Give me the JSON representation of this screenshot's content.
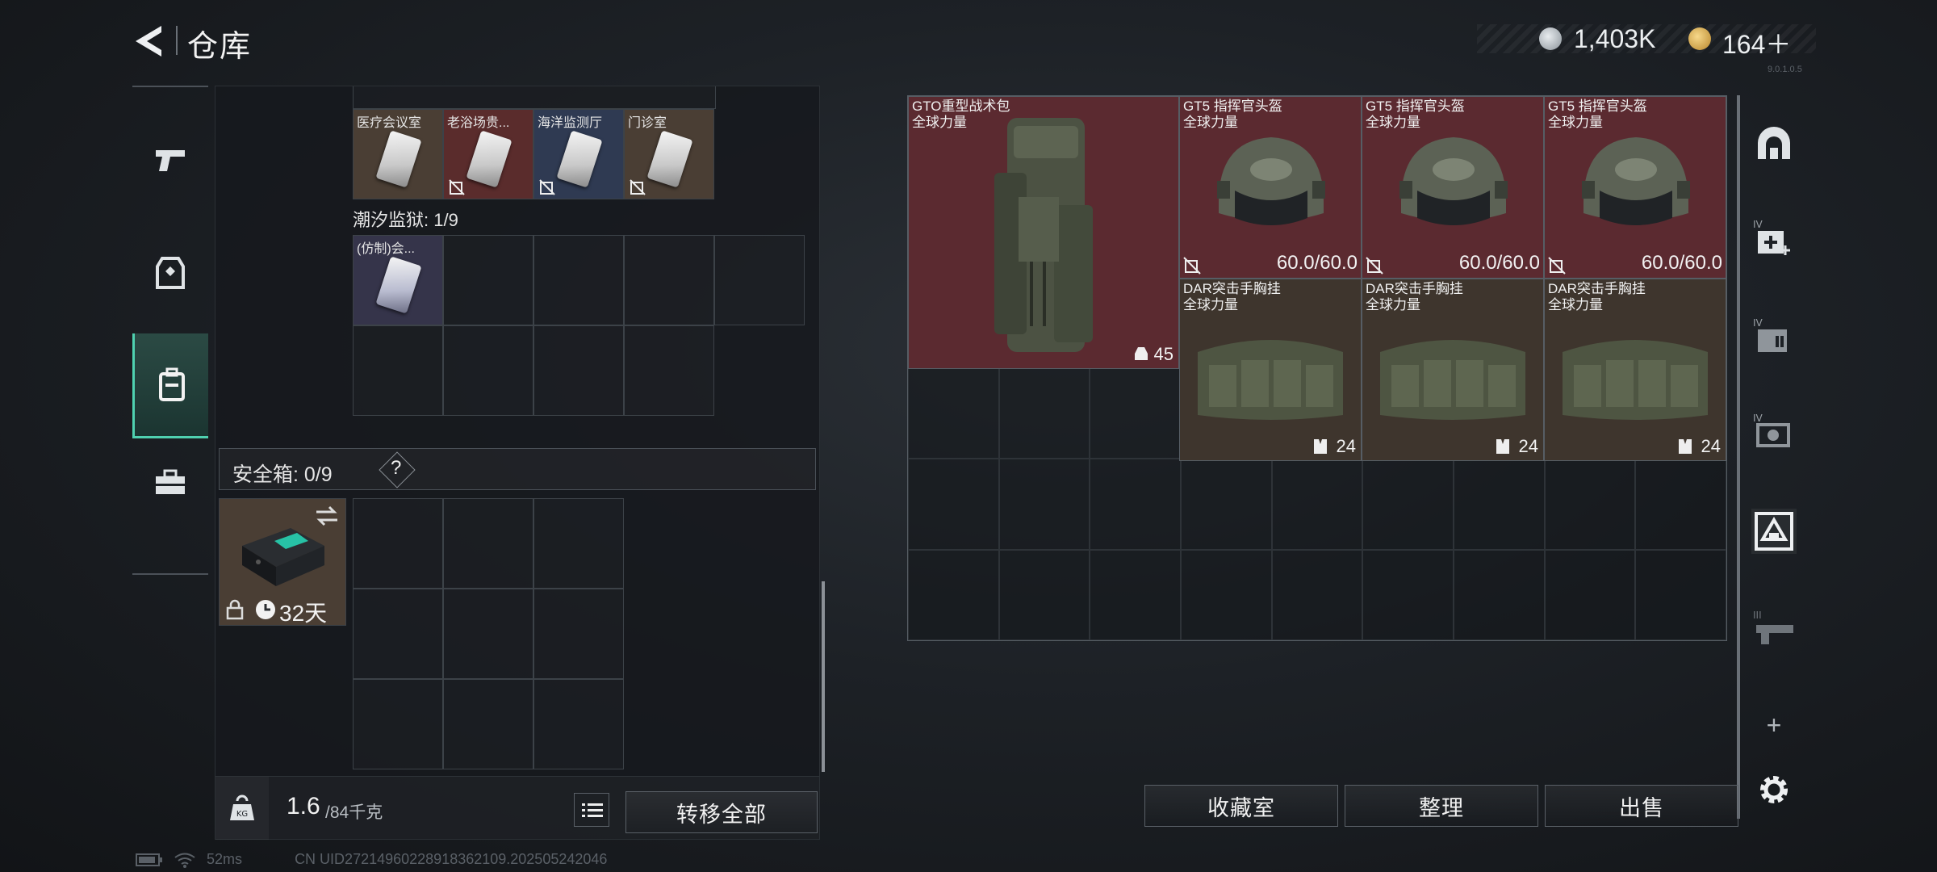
{
  "header": {
    "title": "仓库",
    "currency": [
      {
        "icon": "silver-coin-icon",
        "value": "1,403K"
      },
      {
        "icon": "gold-triangle-icon",
        "value": "164＋"
      }
    ],
    "version": "9.0.1.0.5"
  },
  "left_nav": [
    {
      "icon": "pistol-icon",
      "active": false
    },
    {
      "icon": "armor-vest-icon",
      "active": false
    },
    {
      "icon": "backpack-icon",
      "active": true
    },
    {
      "icon": "briefcase-icon",
      "active": false
    }
  ],
  "keycards_top": [
    {
      "label": "医疗会议室",
      "locked": false,
      "bg": "#4a3e34"
    },
    {
      "label": "老浴场贵...",
      "locked": true,
      "bg": "#5a2c2c"
    },
    {
      "label": "海洋监测厅",
      "locked": true,
      "bg": "#2f3a52"
    },
    {
      "label": "门诊室",
      "locked": true,
      "bg": "#4a3e34"
    }
  ],
  "prison_section": {
    "label": "潮汐监狱: 1/9",
    "card_label": "(仿制)会..."
  },
  "safe_box": {
    "label": "安全箱: 0/9",
    "help": "?",
    "duration": "32天"
  },
  "weight": {
    "current": "1.6",
    "max": "/84千克"
  },
  "buttons": {
    "transfer_all": "转移全部",
    "collection_room": "收藏室",
    "organize": "整理",
    "sell": "出售"
  },
  "right_items": [
    {
      "name": "GTO重型战术包",
      "sub": "全球力量",
      "value": "45",
      "bg": "#5b2a30"
    },
    {
      "name": "GT5 指挥官头盔",
      "sub": "全球力量",
      "value": "60.0/60.0",
      "bg": "#5b2a30"
    },
    {
      "name": "GT5 指挥官头盔",
      "sub": "全球力量",
      "value": "60.0/60.0",
      "bg": "#5b2a30"
    },
    {
      "name": "GT5 指挥官头盔",
      "sub": "全球力量",
      "value": "60.0/60.0",
      "bg": "#5b2a30"
    },
    {
      "name": "DAR突击手胸挂",
      "sub": "全球力量",
      "value": "24",
      "bg": "#3e352d"
    },
    {
      "name": "DAR突击手胸挂",
      "sub": "全球力量",
      "value": "24",
      "bg": "#3e352d"
    },
    {
      "name": "DAR突击手胸挂",
      "sub": "全球力量",
      "value": "24",
      "bg": "#3e352d"
    }
  ],
  "status": {
    "ping": "52ms",
    "uid": "CN UID27214960228918362109.202505242046"
  }
}
